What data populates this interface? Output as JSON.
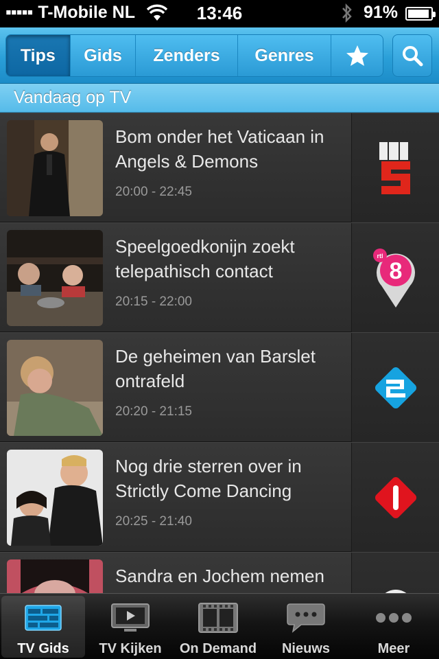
{
  "status_bar": {
    "carrier": "T-Mobile NL",
    "time": "13:46",
    "battery": "91%"
  },
  "nav": {
    "segments": [
      {
        "label": "Tips",
        "active": true
      },
      {
        "label": "Gids",
        "active": false
      },
      {
        "label": "Zenders",
        "active": false
      },
      {
        "label": "Genres",
        "active": false
      }
    ],
    "favorites_icon": "star-icon",
    "search_icon": "search-icon"
  },
  "section": {
    "title": "Vandaag op TV"
  },
  "programs": [
    {
      "title": "Bom onder het Vaticaan in Angels & Demons",
      "time": "20:00 - 22:45",
      "channel_icon": "rtl5-logo"
    },
    {
      "title": "Speelgoedkonijn zoekt telepathisch contact",
      "time": "20:15 - 22:00",
      "channel_icon": "rtl8-logo"
    },
    {
      "title": "De geheimen van Barslet ontrafeld",
      "time": "20:20 - 21:15",
      "channel_icon": "nederland2-logo"
    },
    {
      "title": "Nog drie sterren over in Strictly Come Dancing",
      "time": "20:25 - 21:40",
      "channel_icon": "nederland1-logo"
    },
    {
      "title": "Sandra en Jochem nemen",
      "time": "",
      "channel_icon": "rtl4-logo"
    }
  ],
  "tabs": [
    {
      "label": "TV Gids",
      "icon": "tv-guide-icon",
      "active": true
    },
    {
      "label": "TV Kijken",
      "icon": "tv-icon",
      "active": false
    },
    {
      "label": "On Demand",
      "icon": "film-icon",
      "active": false
    },
    {
      "label": "Nieuws",
      "icon": "chat-icon",
      "active": false
    },
    {
      "label": "Meer",
      "icon": "more-icon",
      "active": false
    }
  ],
  "colors": {
    "accent": "#2a9fd8",
    "active_tab_icon": "#28a9e6"
  }
}
